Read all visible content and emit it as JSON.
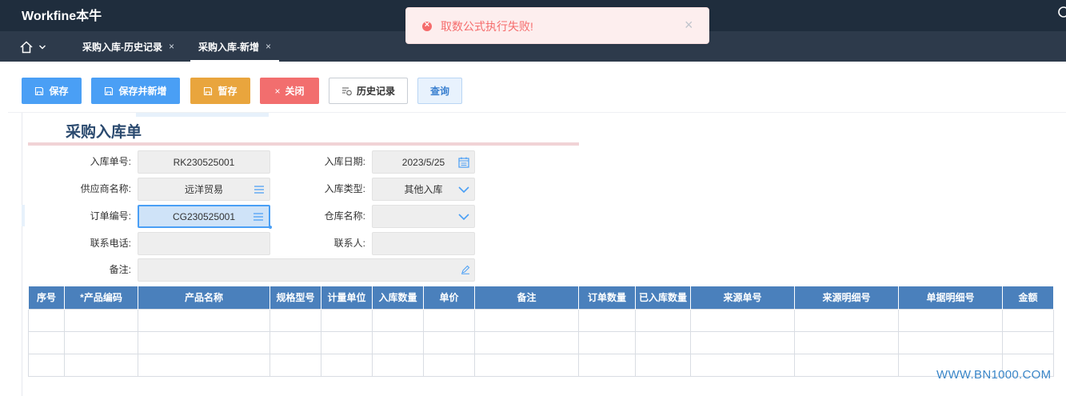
{
  "app": {
    "title": "Workfine本牛"
  },
  "tabs": [
    {
      "label": "采购入库-历史记录",
      "close": "×"
    },
    {
      "label": "采购入库-新增",
      "close": "×"
    }
  ],
  "toolbar": {
    "save": "保存",
    "save_new": "保存并新增",
    "draft": "暂存",
    "close": "关闭",
    "history": "历史记录",
    "query": "查询"
  },
  "form": {
    "title": "采购入库单",
    "fields": {
      "inbound_no": {
        "label": "入库单号:",
        "value": "RK230525001"
      },
      "inbound_date": {
        "label": "入库日期:",
        "value": "2023/5/25"
      },
      "supplier": {
        "label": "供应商名称:",
        "value": "远洋贸易"
      },
      "inbound_type": {
        "label": "入库类型:",
        "value": "其他入库"
      },
      "order_no": {
        "label": "订单编号:",
        "value": "CG230525001"
      },
      "warehouse": {
        "label": "仓库名称:",
        "value": ""
      },
      "phone": {
        "label": "联系电话:",
        "value": ""
      },
      "contact": {
        "label": "联系人:",
        "value": ""
      },
      "remark": {
        "label": "备注:",
        "value": ""
      }
    }
  },
  "table": {
    "columns": [
      "序号",
      "*产品编码",
      "产品名称",
      "规格型号",
      "计量单位",
      "入库数量",
      "单价",
      "备注",
      "订单数量",
      "已入库数量",
      "来源单号",
      "来源明细号",
      "单据明细号",
      "金额"
    ],
    "row_count": 3
  },
  "toast": {
    "message": "取数公式执行失败!",
    "close": "×"
  },
  "watermark": "WWW.BN1000.COM",
  "colors": {
    "accent": "#4a9ff5",
    "header": "#1f2d3d",
    "table_header": "#4a80bc",
    "error": "#f56c6c"
  }
}
